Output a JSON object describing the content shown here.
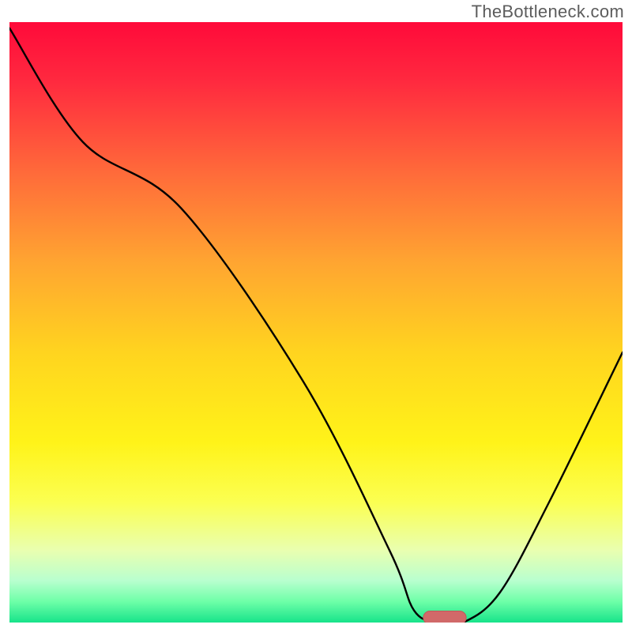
{
  "watermark": "TheBottleneck.com",
  "colors": {
    "gradient_stops": [
      {
        "offset": 0.0,
        "color": "#ff0a3a"
      },
      {
        "offset": 0.1,
        "color": "#ff2a3f"
      },
      {
        "offset": 0.25,
        "color": "#ff6a3a"
      },
      {
        "offset": 0.4,
        "color": "#ffa531"
      },
      {
        "offset": 0.55,
        "color": "#ffd41f"
      },
      {
        "offset": 0.7,
        "color": "#fff319"
      },
      {
        "offset": 0.8,
        "color": "#fbff52"
      },
      {
        "offset": 0.88,
        "color": "#e9ffb0"
      },
      {
        "offset": 0.93,
        "color": "#b9ffcf"
      },
      {
        "offset": 0.965,
        "color": "#6effa8"
      },
      {
        "offset": 1.0,
        "color": "#17e38a"
      }
    ],
    "curve": "#000000",
    "marker_fill": "#d16969",
    "marker_stroke": "#c05858"
  },
  "chart_data": {
    "type": "line",
    "title": "",
    "xlabel": "",
    "ylabel": "",
    "xlim": [
      0,
      100
    ],
    "ylim": [
      0,
      100
    ],
    "series": [
      {
        "name": "bottleneck-curve",
        "x": [
          0,
          12,
          28,
          48,
          62,
          66,
          70,
          74,
          80,
          88,
          100
        ],
        "values": [
          99,
          80,
          69,
          40,
          12,
          2,
          0,
          0,
          5,
          20,
          45
        ]
      }
    ],
    "annotations": [
      {
        "name": "optimum-marker",
        "shape": "capsule",
        "x_center": 71,
        "y_center": 0.8,
        "width": 7,
        "height": 2.2
      }
    ]
  }
}
